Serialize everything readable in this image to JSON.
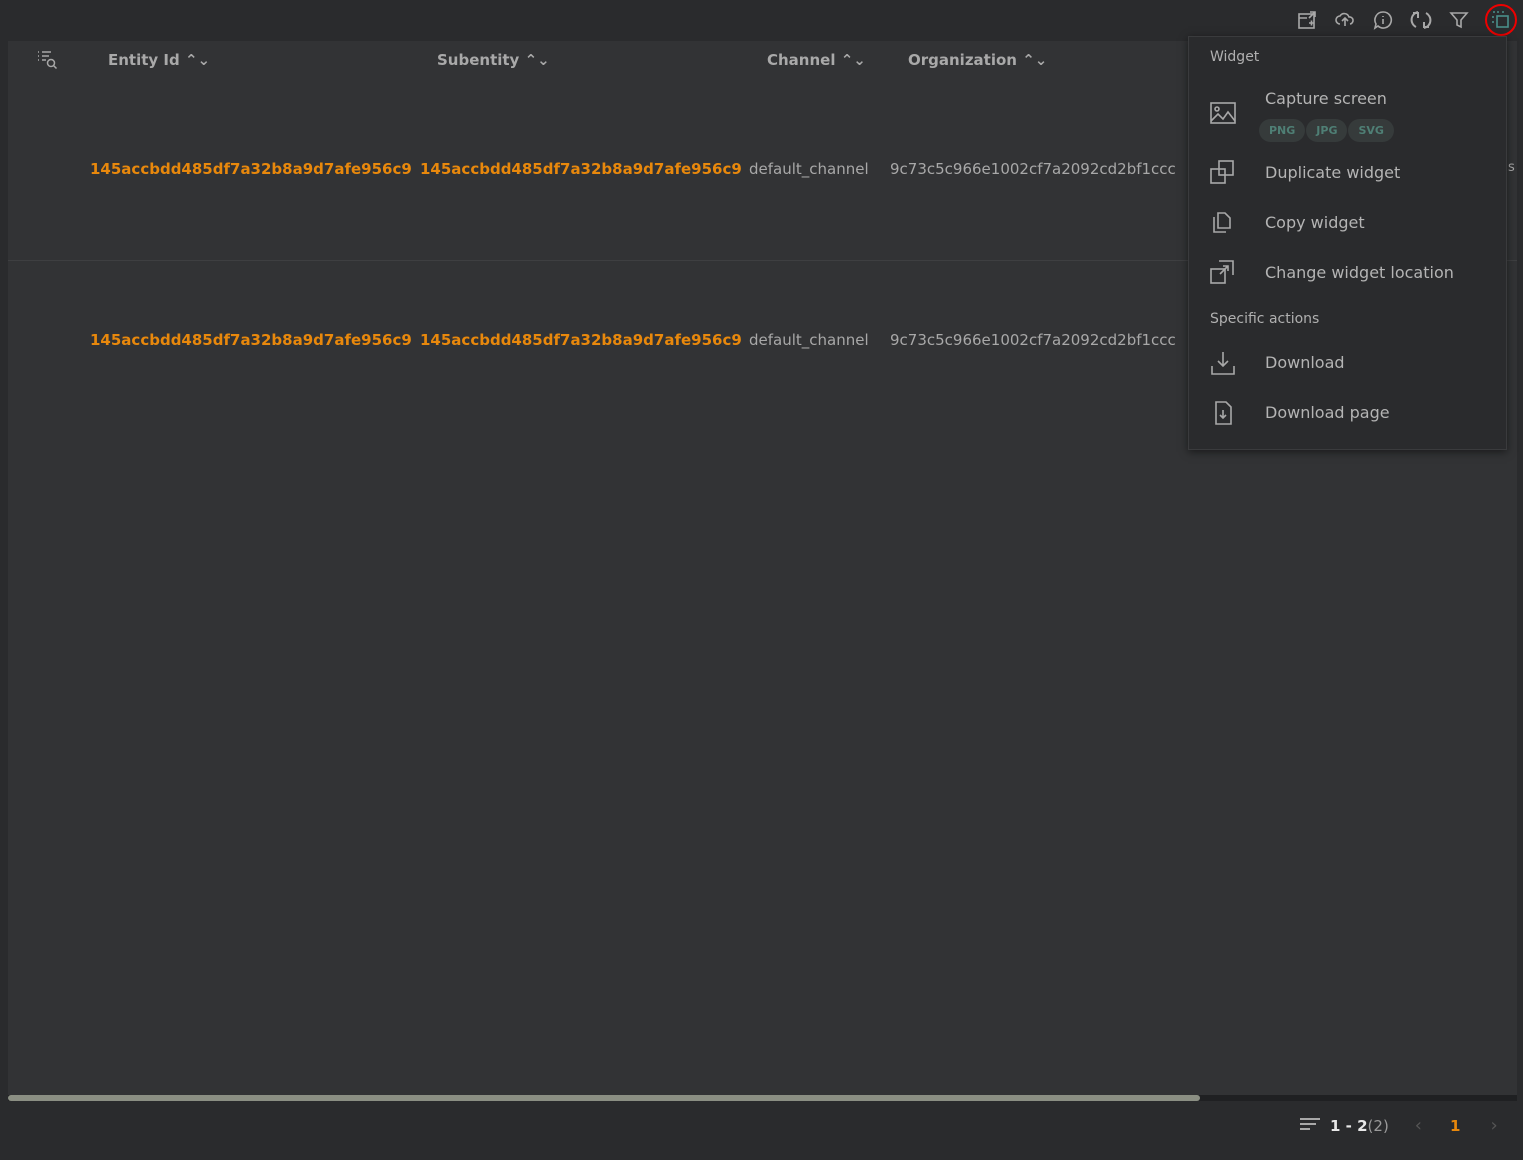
{
  "toolbar": {
    "icons": [
      "export-icon",
      "upload-cloud-icon",
      "info-icon",
      "refresh-icon",
      "filter-icon",
      "widget-menu-icon"
    ]
  },
  "table": {
    "columns": [
      "Entity Id",
      "Subentity",
      "Channel",
      "Organization"
    ],
    "rows": [
      {
        "entity_id": "145accbdd485df7a32b8a9d7afe956c9",
        "subentity": "145accbdd485df7a32b8a9d7afe956c9",
        "channel": "default_channel",
        "organization": "9c73c5c966e1002cf7a2092cd2bf1ccc"
      },
      {
        "entity_id": "145accbdd485df7a32b8a9d7afe956c9",
        "subentity": "145accbdd485df7a32b8a9d7afe956c9",
        "channel": "default_channel",
        "organization": "9c73c5c966e1002cf7a2092cd2bf1ccc"
      }
    ],
    "clipped_text": "s"
  },
  "menu": {
    "section_widget": "Widget",
    "capture": "Capture screen",
    "formats": [
      "PNG",
      "JPG",
      "SVG"
    ],
    "duplicate": "Duplicate widget",
    "copy": "Copy widget",
    "change_location": "Change widget location",
    "section_specific": "Specific actions",
    "download": "Download",
    "download_page": "Download page"
  },
  "pagination": {
    "range": "1 - 2",
    "total": "(2)",
    "current_page": "1"
  },
  "colors": {
    "accent": "#e8880c",
    "highlight_ring": "#e00000",
    "chip_text": "#4f7f75"
  },
  "scroll_position": 0.79
}
